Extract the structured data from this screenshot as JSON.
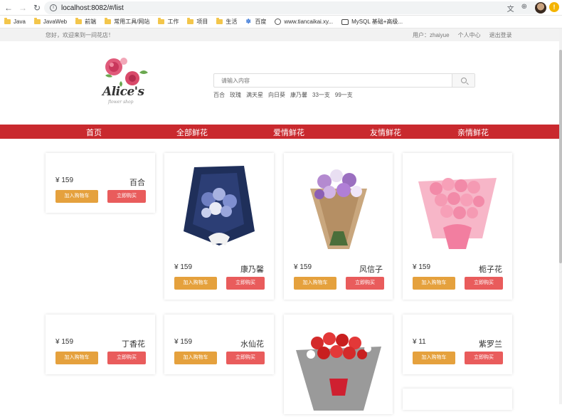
{
  "browser": {
    "url": "localhost:8082/#/list",
    "bookmarks": [
      "Java",
      "JavaWeb",
      "前端",
      "常用工具/网站",
      "工作",
      "项目",
      "生活",
      "百度",
      "www.tiancaikai.xy...",
      "MySQL 基础+高级..."
    ]
  },
  "topbar": {
    "welcome": "您好，欢迎来到一间花店！",
    "user": "用户：zhaiyue",
    "personal_center": "个人中心",
    "logout": "退出登录"
  },
  "logo": {
    "text": "Alice's",
    "subtitle": "flower shop"
  },
  "search": {
    "placeholder": "请输入内容",
    "hot_terms": [
      "百合",
      "玫瑰",
      "满天星",
      "向日葵",
      "康乃馨",
      "33一支",
      "99一支"
    ]
  },
  "nav": [
    "首页",
    "全部鲜花",
    "爱情鲜花",
    "友情鲜花",
    "亲情鲜花"
  ],
  "buttons": {
    "add_to_cart": "加入购物车",
    "buy_now": "立即购买"
  },
  "products": [
    {
      "price": "¥ 159",
      "name": "百合",
      "has_image": false
    },
    {
      "price": "¥ 159",
      "name": "康乃馨",
      "has_image": true,
      "image": "blue-bouquet"
    },
    {
      "price": "¥ 159",
      "name": "风信子",
      "has_image": true,
      "image": "purple-bouquet"
    },
    {
      "price": "¥ 159",
      "name": "栀子花",
      "has_image": true,
      "image": "pink-rose-bouquet"
    },
    {
      "price": "¥ 159",
      "name": "丁香花",
      "has_image": false
    },
    {
      "price": "¥ 159",
      "name": "水仙花",
      "has_image": false
    },
    {
      "price": "",
      "name": "",
      "has_image": true,
      "image": "red-rose-bouquet"
    },
    {
      "price": "¥ 11",
      "name": "紫罗兰",
      "has_image": false
    }
  ],
  "colors": {
    "nav_red": "#c9292e",
    "cart_orange": "#e5a13d",
    "buy_red": "#e95c5c"
  }
}
